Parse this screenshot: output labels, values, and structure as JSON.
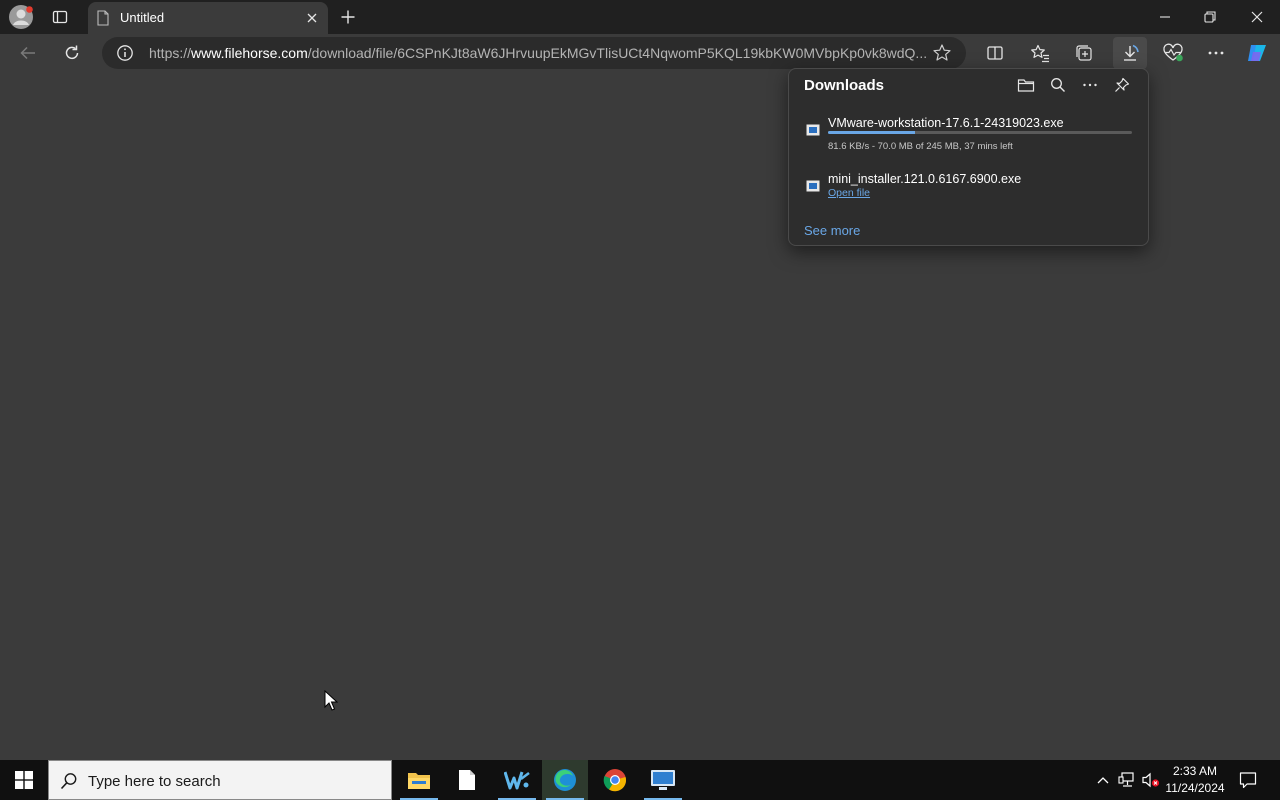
{
  "browser": {
    "tab": {
      "title": "Untitled"
    },
    "address": {
      "scheme": "https://",
      "host": "www.filehorse.com",
      "path": "/download/file/6CSPnKJt8aW6JHrvuupEkMGvTlisUCt4NqwomP5KQL19kbKW0MVbpKp0vk8wdQ..."
    }
  },
  "downloads": {
    "title": "Downloads",
    "items": [
      {
        "name": "VMware-workstation-17.6.1-24319023.exe",
        "status": "81.6 KB/s - 70.0 MB of 245 MB, 37 mins left",
        "progress_fraction": 0.286
      },
      {
        "name": "mini_installer.121.0.6167.6900.exe",
        "action": "Open file"
      }
    ],
    "see_more": "See more"
  },
  "taskbar": {
    "search_placeholder": "Type here to search",
    "time": "2:33 AM",
    "date": "11/24/2024"
  },
  "colors": {
    "accent": "#6aa7e6",
    "page_bg": "#3b3b3b",
    "chrome_bg": "#202020"
  }
}
